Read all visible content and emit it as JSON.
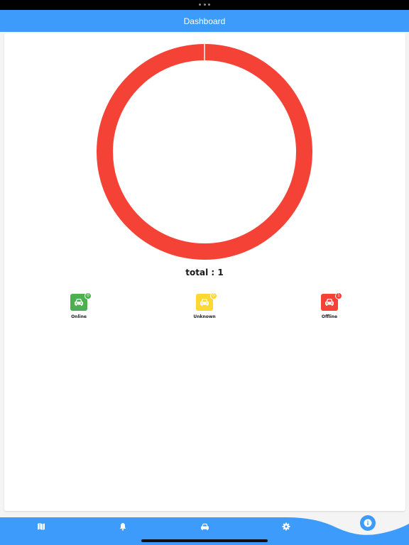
{
  "header": {
    "title": "Dashboard"
  },
  "chart_data": {
    "type": "pie",
    "categories": [
      "Online",
      "Unknown",
      "Offline"
    ],
    "values": [
      0,
      0,
      1
    ],
    "colors": [
      "#4caf50",
      "#fdd835",
      "#f44336"
    ]
  },
  "summary": {
    "total_label": "total : 1",
    "statuses": [
      {
        "label": "Online",
        "count": "0",
        "color": "#4caf50"
      },
      {
        "label": "Unknown",
        "count": "0",
        "color": "#fdd835"
      },
      {
        "label": "Offline",
        "count": "1",
        "color": "#f44336"
      }
    ]
  },
  "bottom_nav": {
    "items": [
      {
        "icon": "map-icon"
      },
      {
        "icon": "bell-icon"
      },
      {
        "icon": "car-icon"
      },
      {
        "icon": "gear-icon"
      }
    ],
    "fab_icon": "info-icon"
  },
  "colors": {
    "primary": "#3d9bfc",
    "background": "#ffffff"
  }
}
